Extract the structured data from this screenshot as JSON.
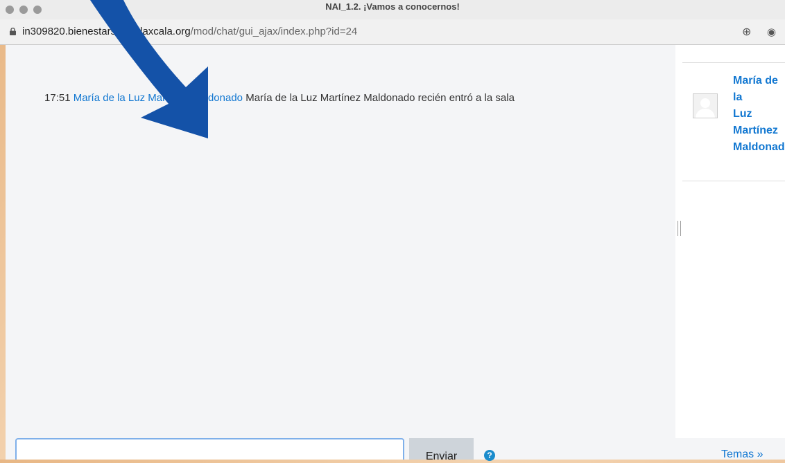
{
  "window": {
    "title": "NAI_1.2. ¡Vamos a conocernos!"
  },
  "address_bar": {
    "domain": "in309820.bienestarsocialtlaxcala.org",
    "path": "/mod/chat/gui_ajax/index.php?id=24",
    "zoom_icon": "⊕",
    "eye_icon": "◉"
  },
  "chat": {
    "messages": [
      {
        "time": "17:51",
        "author": "María de la Luz Martínez Maldonado",
        "text": "María de la Luz Martínez Maldonado recién entró a la sala"
      }
    ]
  },
  "sidebar": {
    "users": [
      {
        "name_lines": [
          "María de la",
          "Luz",
          "Martínez",
          "Maldonado"
        ]
      }
    ]
  },
  "composer": {
    "input_value": "",
    "send_label": "Enviar",
    "help_icon": "?",
    "themes_label": "Temas »"
  },
  "colors": {
    "link": "#1177d1",
    "arrow": "#1452a8",
    "background": "#eec59b"
  },
  "icons": [
    "lock-icon",
    "zoom-icon",
    "eye-icon",
    "user-avatar-icon",
    "help-icon",
    "arrow-overlay"
  ]
}
